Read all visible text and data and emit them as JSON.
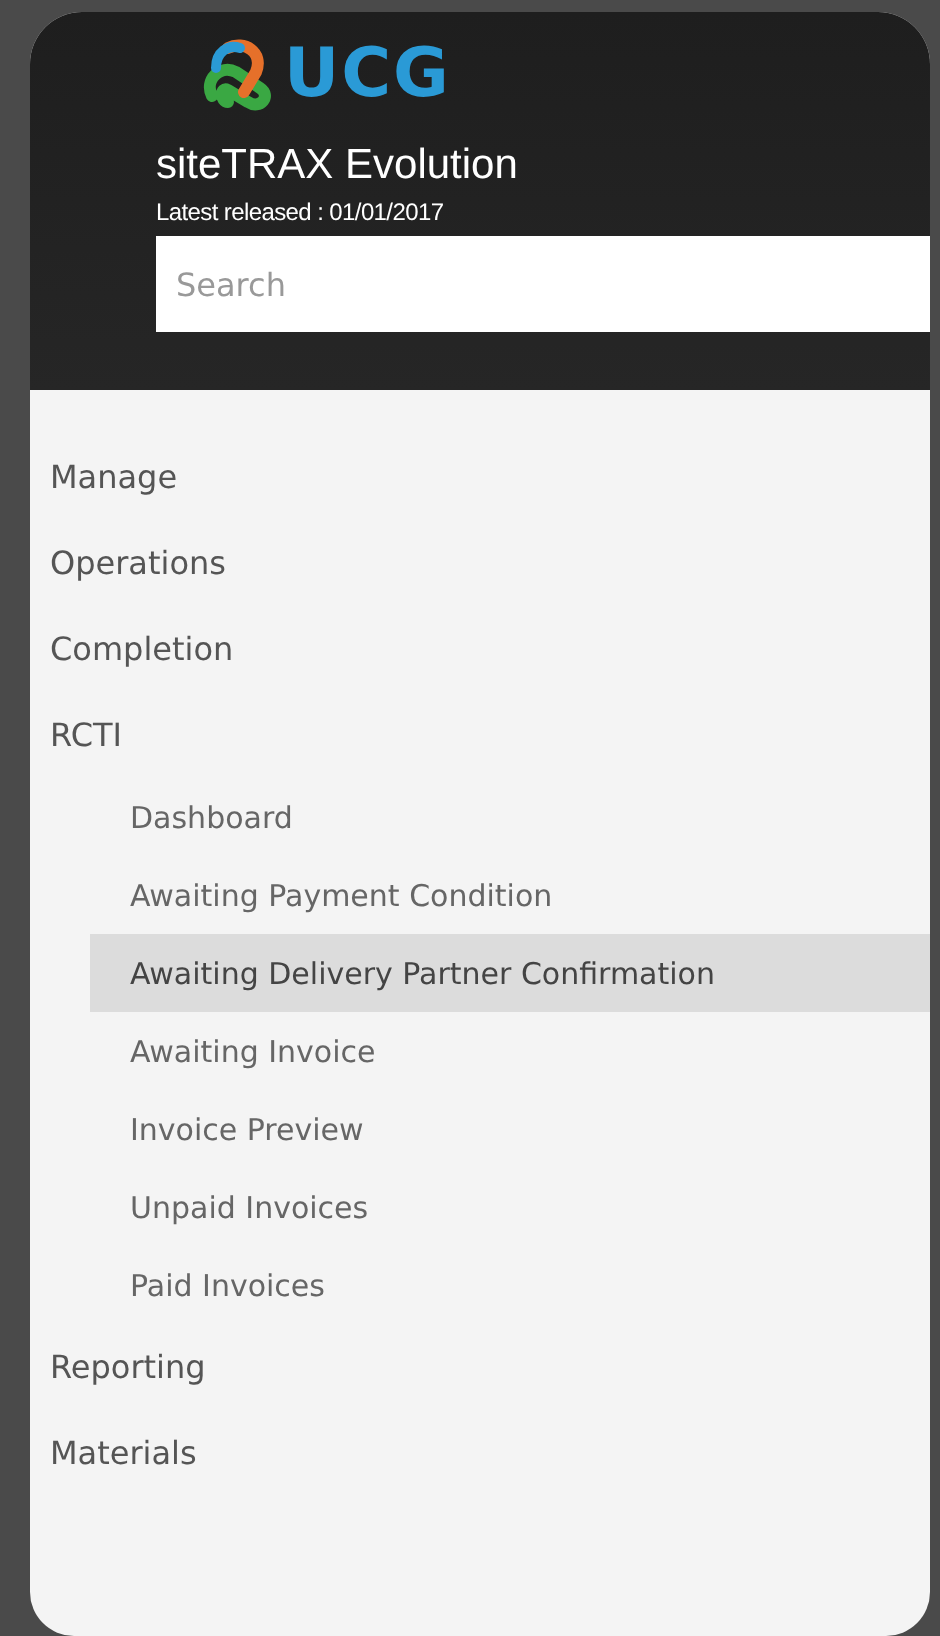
{
  "header": {
    "logo_text": "UCG",
    "title": "siteTRAX Evolution",
    "subtitle": "Latest released : 01/01/2017",
    "search": {
      "placeholder": "Search"
    }
  },
  "menu": [
    {
      "label": "Manage",
      "selected": false
    },
    {
      "label": "Operations",
      "selected": false
    },
    {
      "label": "Completion",
      "selected": false
    },
    {
      "label": "RCTI",
      "selected": false,
      "children": [
        {
          "label": "Dashboard",
          "selected": false
        },
        {
          "label": "Awaiting Payment Condition",
          "selected": false
        },
        {
          "label": "Awaiting Delivery Partner Confirmation",
          "selected": true
        },
        {
          "label": "Awaiting Invoice",
          "selected": false
        },
        {
          "label": "Invoice Preview",
          "selected": false
        },
        {
          "label": "Unpaid Invoices",
          "selected": false
        },
        {
          "label": "Paid Invoices",
          "selected": false
        }
      ]
    },
    {
      "label": "Reporting",
      "selected": false
    },
    {
      "label": "Materials",
      "selected": false
    }
  ]
}
